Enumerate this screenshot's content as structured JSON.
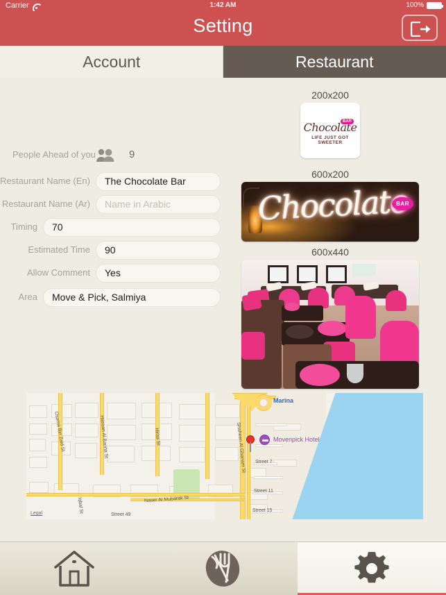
{
  "statusbar": {
    "carrier": "Carrier",
    "wifi_icon": "wifi-icon",
    "time": "1:42 AM",
    "battery_percent": "100%",
    "battery_icon": "battery-full-icon"
  },
  "header": {
    "title": "Setting",
    "logout_icon": "logout-icon",
    "background_color": "#cc5150"
  },
  "tabs": {
    "items": [
      {
        "label": "Account",
        "selected": false
      },
      {
        "label": "Restaurant",
        "selected": true
      }
    ],
    "active_color": "#665b53",
    "inactive_color": "#f2f0e6"
  },
  "form": {
    "people_ahead": {
      "label": "People Ahead of you",
      "icon": "people-icon",
      "value": "9"
    },
    "fields": [
      {
        "label": "Restaurant Name (En)",
        "value": "The Chocolate Bar",
        "placeholder": "",
        "is_placeholder": false
      },
      {
        "label": "Restaurant Name (Ar)",
        "value": "Name in Arabic",
        "placeholder": "Name in Arabic",
        "is_placeholder": true
      },
      {
        "label": "Timing",
        "value": "70",
        "placeholder": "",
        "is_placeholder": false
      },
      {
        "label": "Estimated Time",
        "value": "90",
        "placeholder": "",
        "is_placeholder": false
      },
      {
        "label": "Allow Comment",
        "value": "Yes",
        "placeholder": "",
        "is_placeholder": false
      },
      {
        "label": "Area",
        "value": "Move & Pick, Salmiya",
        "placeholder": "",
        "is_placeholder": false
      }
    ]
  },
  "images": {
    "logo": {
      "caption": "200x200",
      "brand_script": "Chocolate",
      "brand_badge": "BAR",
      "tagline": "LIFE JUST GOT SWEETER"
    },
    "banner": {
      "caption": "600x200",
      "sign_text": "Chocolate",
      "sign_badge": "BAR"
    },
    "interior": {
      "caption": "600x440"
    }
  },
  "map": {
    "place_label": "Marina",
    "poi_label": "Movenpick Hotel",
    "legal_label": "Legal",
    "streets": [
      "Osama Bin Zaid St",
      "Hassan Al Banna St",
      "Hiraa St",
      "Shaheen Al Ghanam St",
      "Naser Al Mubarak St",
      "Iqbal St",
      "Street 7",
      "Street 11",
      "Street 15",
      "Street 49"
    ]
  },
  "bottom_tabs": {
    "items": [
      {
        "icon": "home-icon",
        "selected": false
      },
      {
        "icon": "restaurant-cutlery-icon",
        "selected": false
      },
      {
        "icon": "gear-icon",
        "selected": true
      }
    ],
    "selected_indicator_color": "#e8565a"
  }
}
